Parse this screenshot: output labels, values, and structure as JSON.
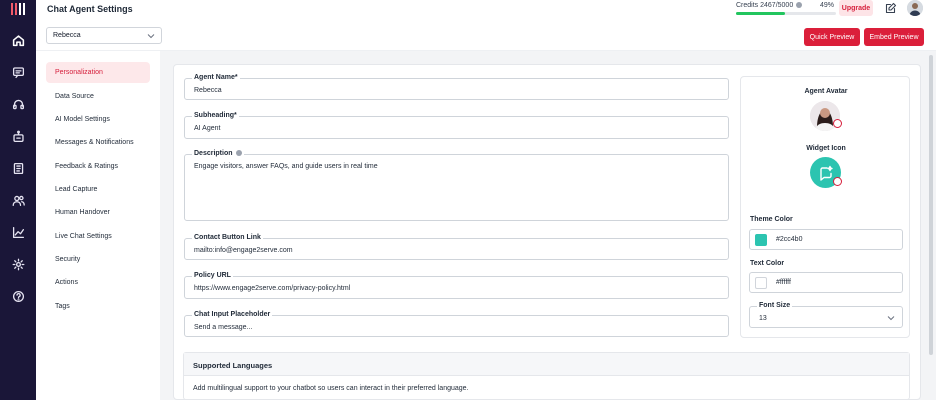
{
  "header": {
    "title": "Chat Agent Settings",
    "credits_label": "Credits 2467/5000",
    "credits_fraction": 0.49,
    "credits_percent": "49%",
    "upgrade_label": "Upgrade"
  },
  "toolbar": {
    "agent_selected": "Rebecca",
    "quick_preview_label": "Quick Preview",
    "embed_preview_label": "Embed Preview"
  },
  "sidebar": {
    "items": [
      {
        "label": "Personalization",
        "active": true
      },
      {
        "label": "Data Source"
      },
      {
        "label": "AI Model Settings"
      },
      {
        "label": "Messages & Notifications"
      },
      {
        "label": "Feedback & Ratings"
      },
      {
        "label": "Lead Capture"
      },
      {
        "label": "Human Handover"
      },
      {
        "label": "Live Chat Settings"
      },
      {
        "label": "Security"
      },
      {
        "label": "Actions"
      },
      {
        "label": "Tags"
      }
    ]
  },
  "form": {
    "agent_name": {
      "label": "Agent Name*",
      "value": "Rebecca"
    },
    "subheading": {
      "label": "Subheading*",
      "value": "AI Agent"
    },
    "description": {
      "label": "Description",
      "value": "Engage visitors, answer FAQs, and guide users in real time"
    },
    "contact_link": {
      "label": "Contact Button Link",
      "value": "mailto:info@engage2serve.com"
    },
    "policy_url": {
      "label": "Policy URL",
      "value": "https://www.engage2serve.com/privacy-policy.html"
    },
    "chat_placeholder": {
      "label": "Chat Input Placeholder",
      "value": "Send a message..."
    }
  },
  "appearance": {
    "avatar_label": "Agent Avatar",
    "widget_icon_label": "Widget Icon",
    "theme_color_label": "Theme Color",
    "theme_color": "#2cc4b0",
    "text_color_label": "Text Color",
    "text_color": "#ffffff",
    "font_size_label": "Font Size",
    "font_size": "13"
  },
  "languages": {
    "title": "Supported Languages",
    "description": "Add multilingual support to your chatbot so users can interact in their preferred language."
  },
  "colors": {
    "accent": "#db1f3a",
    "rail": "#1a1638",
    "progress": "#22c55e"
  }
}
